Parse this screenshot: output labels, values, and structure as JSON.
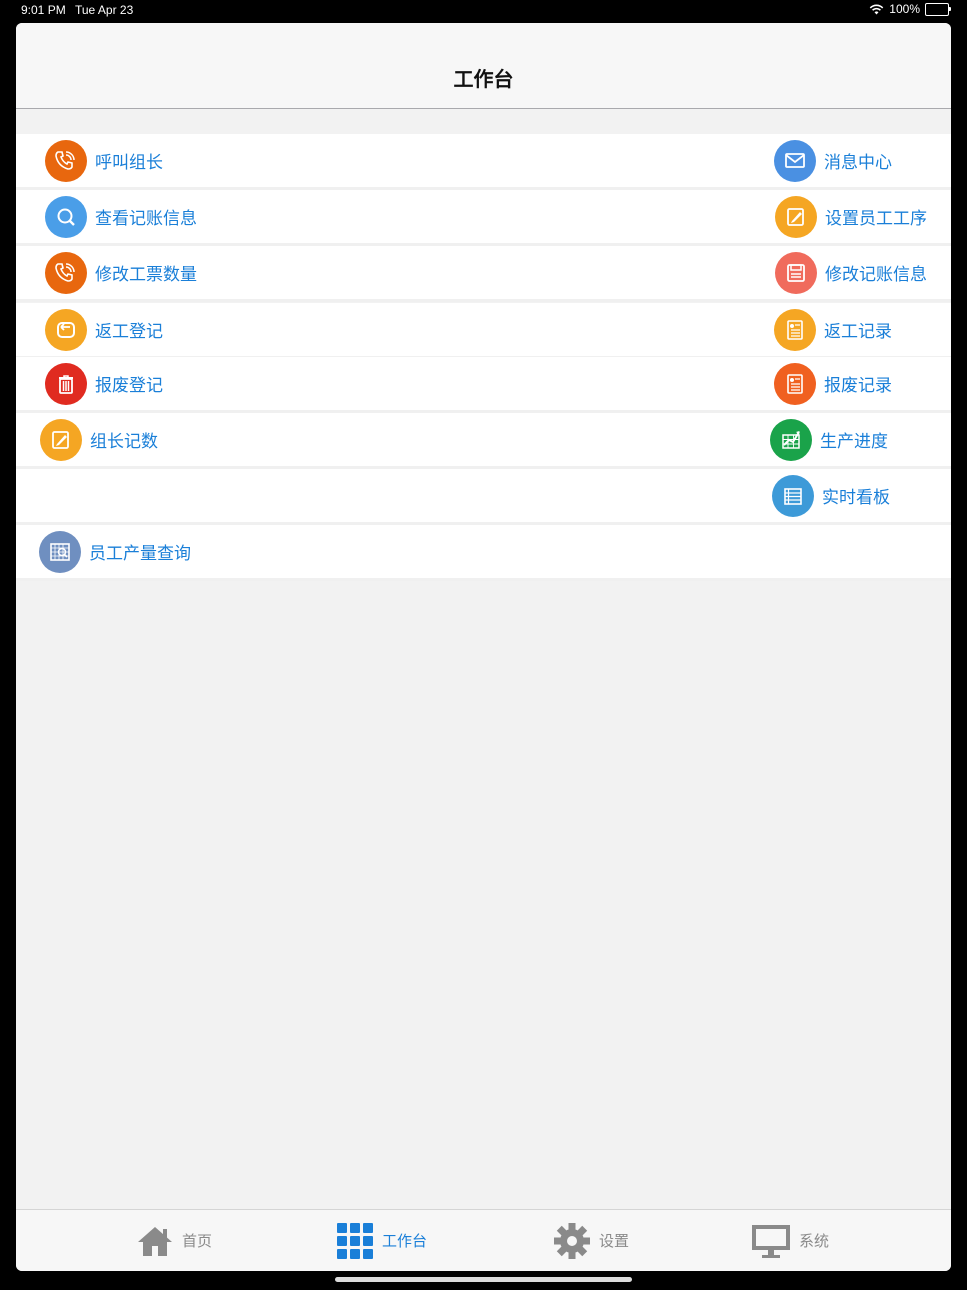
{
  "status_bar": {
    "time": "9:01 PM",
    "date": "Tue Apr 23",
    "battery": "100%"
  },
  "nav": {
    "title": "工作台"
  },
  "rows": [
    {
      "left": {
        "label": "呼叫组长",
        "icon": "phone-icon",
        "color": "#e8670e"
      },
      "right": {
        "label": "消息中心",
        "icon": "mail-icon",
        "color": "#4a90e2"
      }
    },
    {
      "left": {
        "label": "查看记账信息",
        "icon": "search-icon",
        "color": "#4a9ee8"
      },
      "right": {
        "label": "设置员工工序",
        "icon": "edit-icon",
        "color": "#f5a623"
      }
    },
    {
      "left": {
        "label": "修改工票数量",
        "icon": "phone-icon",
        "color": "#e8670e"
      },
      "right": {
        "label": "修改记账信息",
        "icon": "save-icon",
        "color": "#f06b5c"
      }
    },
    {
      "left": {
        "label": "返工登记",
        "icon": "return-icon",
        "color": "#f5a623"
      },
      "right": {
        "label": "返工记录",
        "icon": "document-icon",
        "color": "#f5a623"
      }
    },
    {
      "left": {
        "label": "报废登记",
        "icon": "trash-icon",
        "color": "#e02b20"
      },
      "right": {
        "label": "报废记录",
        "icon": "document-icon",
        "color": "#f06020"
      }
    },
    {
      "left": {
        "label": "组长记数",
        "icon": "edit-icon",
        "color": "#f5a623"
      },
      "right": {
        "label": "生产进度",
        "icon": "chart-icon",
        "color": "#1aa34a"
      }
    },
    {
      "left": null,
      "right": {
        "label": "实时看板",
        "icon": "list-icon",
        "color": "#3d9ad8"
      }
    },
    {
      "left": {
        "label": "员工产量查询",
        "icon": "report-icon",
        "color": "#6f8fc0"
      },
      "right": null
    }
  ],
  "tabs": [
    {
      "label": "首页",
      "icon": "home-icon",
      "active": false
    },
    {
      "label": "工作台",
      "icon": "grid-icon",
      "active": true
    },
    {
      "label": "设置",
      "icon": "gear-icon",
      "active": false
    },
    {
      "label": "系统",
      "icon": "monitor-icon",
      "active": false
    }
  ]
}
